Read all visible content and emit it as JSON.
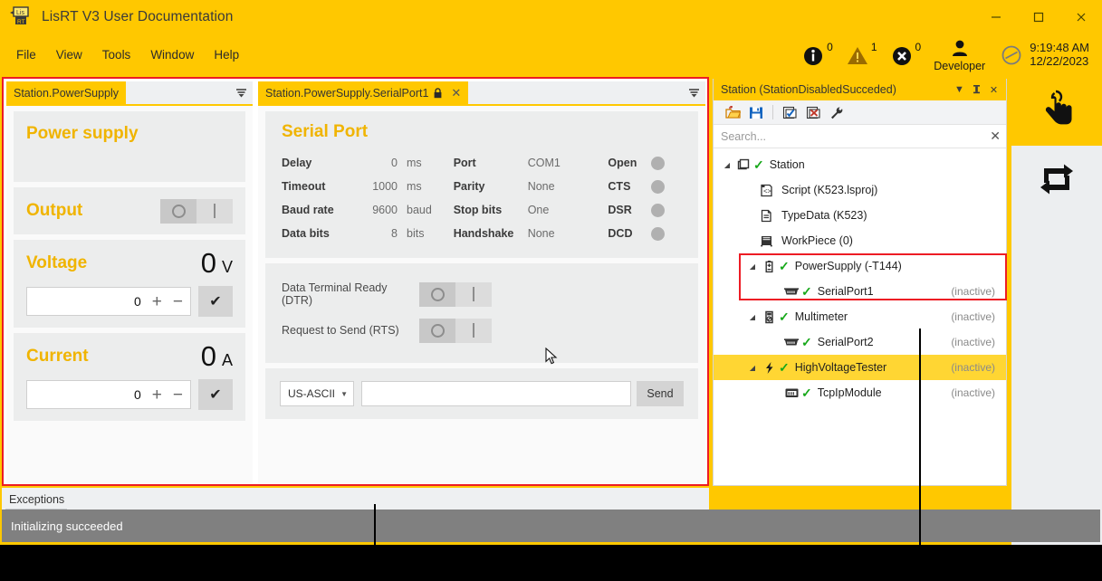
{
  "window": {
    "title": "LisRT V3 User Documentation",
    "logo_icon": "lisrt-logo-icon",
    "controls": {
      "minimize": "—",
      "maximize": "☐",
      "close": "✕"
    },
    "accent_color": "#FFC800",
    "highlight_color": "#ED1C24"
  },
  "menubar": {
    "items": [
      {
        "label": "File"
      },
      {
        "label": "View"
      },
      {
        "label": "Tools"
      },
      {
        "label": "Window"
      },
      {
        "label": "Help"
      }
    ],
    "status": {
      "info": {
        "icon": "info-icon",
        "count": "0"
      },
      "warning": {
        "icon": "warning-icon",
        "count": "1"
      },
      "error": {
        "icon": "error-icon",
        "count": "0"
      },
      "user": {
        "icon": "user-icon",
        "label": "Developer"
      },
      "clock": {
        "icon": "clock-disabled-icon",
        "time": "9:19:48 AM",
        "date": "12/22/2023"
      }
    }
  },
  "power_supply_panel": {
    "tab_label": "Station.PowerSupply",
    "tab_menu_icon": "tab-list-icon",
    "title": "Power supply",
    "output": {
      "label": "Output",
      "off_icon": "circle-icon",
      "on_icon": "bar-icon"
    },
    "voltage": {
      "label": "Voltage",
      "value": "0",
      "unit": "V",
      "setpoint": "0",
      "plus": "+",
      "minus": "−",
      "confirm_icon": "check-icon"
    },
    "current": {
      "label": "Current",
      "value": "0",
      "unit": "A",
      "setpoint": "0",
      "plus": "+",
      "minus": "−",
      "confirm_icon": "check-icon"
    }
  },
  "serial_port_panel": {
    "tab_label": "Station.PowerSupply.SerialPort1",
    "tab_lock_icon": "lock-icon",
    "tab_close_icon": "close-icon",
    "tab_menu_icon": "tab-list-icon",
    "title": "Serial Port",
    "settings_col1": [
      {
        "key": "Delay",
        "value": "0",
        "unit": "ms"
      },
      {
        "key": "Timeout",
        "value": "1000",
        "unit": "ms"
      },
      {
        "key": "Baud rate",
        "value": "9600",
        "unit": "baud"
      },
      {
        "key": "Data bits",
        "value": "8",
        "unit": "bits"
      }
    ],
    "settings_col2": [
      {
        "key": "Port",
        "value": "COM1"
      },
      {
        "key": "Parity",
        "value": "None"
      },
      {
        "key": "Stop bits",
        "value": "One"
      },
      {
        "key": "Handshake",
        "value": "None"
      }
    ],
    "indicators": [
      {
        "key": "Open",
        "state": "off"
      },
      {
        "key": "CTS",
        "state": "off"
      },
      {
        "key": "DSR",
        "state": "off"
      },
      {
        "key": "DCD",
        "state": "off"
      }
    ],
    "signals": [
      {
        "label": "Data Terminal Ready (DTR)",
        "state": "off"
      },
      {
        "label": "Request to Send (RTS)",
        "state": "off"
      }
    ],
    "send_row": {
      "encoding": "US-ASCII",
      "encoding_caret": "▼",
      "input_value": "",
      "input_placeholder": "",
      "send_label": "Send"
    }
  },
  "exceptions": {
    "label": "Exceptions"
  },
  "station_tree": {
    "title": "Station (StationDisabledSucceded)",
    "title_buttons": [
      {
        "icon": "chevron-down-icon",
        "glyph": "▼"
      },
      {
        "icon": "pin-icon",
        "glyph": "⤓"
      },
      {
        "icon": "close-icon",
        "glyph": "✕"
      }
    ],
    "toolbar": [
      {
        "icon": "open-folder-icon"
      },
      {
        "icon": "save-icon"
      },
      {
        "icon": "check-document-icon"
      },
      {
        "icon": "delete-document-icon"
      },
      {
        "icon": "wrench-icon"
      }
    ],
    "search": {
      "placeholder": "Search...",
      "clear_icon": "close-icon"
    },
    "nodes": [
      {
        "indent": 0,
        "twisty": "◢",
        "icon": "station-icon",
        "check": "✓",
        "label": "Station",
        "state": "",
        "selected": false
      },
      {
        "indent": 1,
        "twisty": "",
        "icon": "script-icon",
        "check": "",
        "label": "Script (K523.lsproj)",
        "state": "",
        "selected": false
      },
      {
        "indent": 1,
        "twisty": "",
        "icon": "typedata-icon",
        "check": "",
        "label": "TypeData (K523)",
        "state": "",
        "selected": false
      },
      {
        "indent": 1,
        "twisty": "",
        "icon": "workpiece-icon",
        "check": "",
        "label": "WorkPiece (0)",
        "state": "",
        "selected": false
      },
      {
        "indent": 1,
        "twisty": "◢",
        "icon": "battery-icon",
        "check": "✓",
        "label": "PowerSupply (-T144)",
        "state": "",
        "selected": false
      },
      {
        "indent": 2,
        "twisty": "",
        "icon": "serial-port-icon",
        "check": "✓",
        "label": "SerialPort1",
        "state": "(inactive)",
        "selected": false
      },
      {
        "indent": 1,
        "twisty": "◢",
        "icon": "multimeter-icon",
        "check": "✓",
        "label": "Multimeter",
        "state": "(inactive)",
        "selected": false
      },
      {
        "indent": 2,
        "twisty": "",
        "icon": "serial-port-icon",
        "check": "✓",
        "label": "SerialPort2",
        "state": "(inactive)",
        "selected": false
      },
      {
        "indent": 1,
        "twisty": "◢",
        "icon": "bolt-icon",
        "check": "✓",
        "label": "HighVoltageTester",
        "state": "(inactive)",
        "selected": true
      },
      {
        "indent": 2,
        "twisty": "",
        "icon": "tcpip-icon",
        "check": "✓",
        "label": "TcpIpModule",
        "state": "(inactive)",
        "selected": false
      }
    ]
  },
  "rail": {
    "buttons": [
      {
        "icon": "touch-hand-icon",
        "active": true
      },
      {
        "icon": "swap-arrows-icon",
        "active": false
      }
    ]
  },
  "statusbar": {
    "message": "Initializing succeeded"
  },
  "cursor": {
    "icon": "mouse-pointer-icon"
  }
}
